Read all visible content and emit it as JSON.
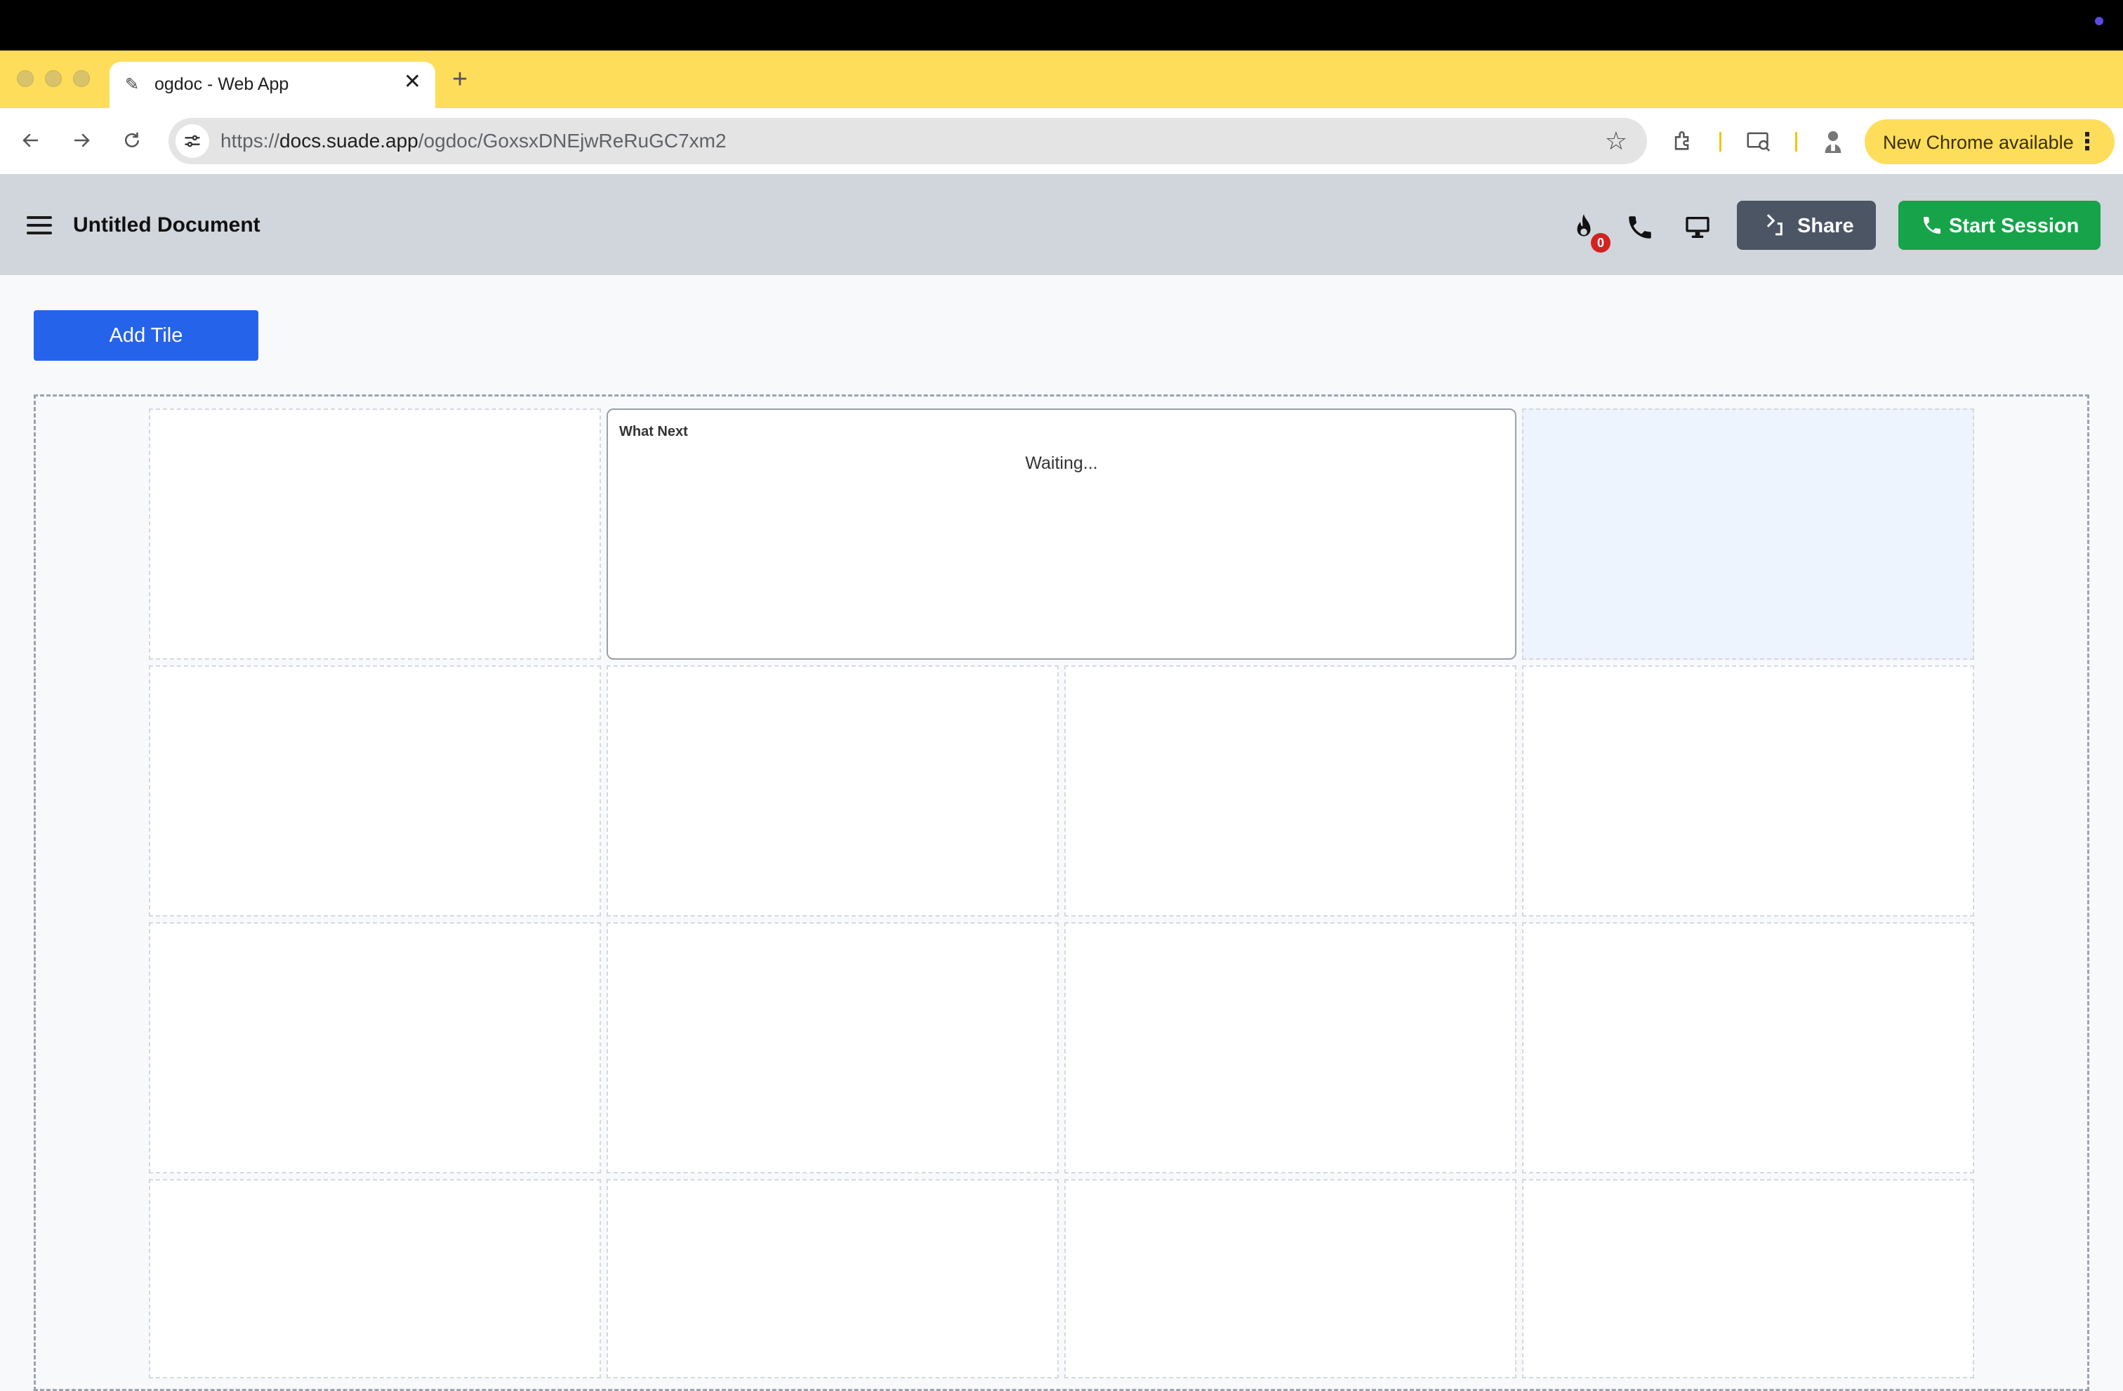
{
  "browser": {
    "tab_title": "ogdoc - Web App",
    "url_scheme": "https://",
    "url_host": "docs.suade.app",
    "url_path": "/ogdoc/GoxsxDNEjwReRuGC7xm2",
    "update_label": "New Chrome available"
  },
  "header": {
    "title": "Untitled Document",
    "notification_count": "0",
    "share_label": "Share",
    "start_session_label": "Start Session"
  },
  "main": {
    "add_tile_label": "Add Tile",
    "tiles": [
      {
        "title": "What Next",
        "status": "Waiting..."
      }
    ]
  },
  "colors": {
    "chrome_frame": "#fedd5a",
    "header_bg": "#d1d5dc",
    "primary_blue": "#2563eb",
    "share_gray": "#4b5563",
    "session_green": "#16a34a",
    "badge_red": "#d32222"
  },
  "icons": [
    "back-icon",
    "forward-icon",
    "reload-icon",
    "site-info-icon",
    "star-icon",
    "extensions-icon",
    "cast-search-icon",
    "profile-icon",
    "menu-icon",
    "flame-icon",
    "phone-icon",
    "monitor-icon",
    "share-arrow-icon"
  ]
}
